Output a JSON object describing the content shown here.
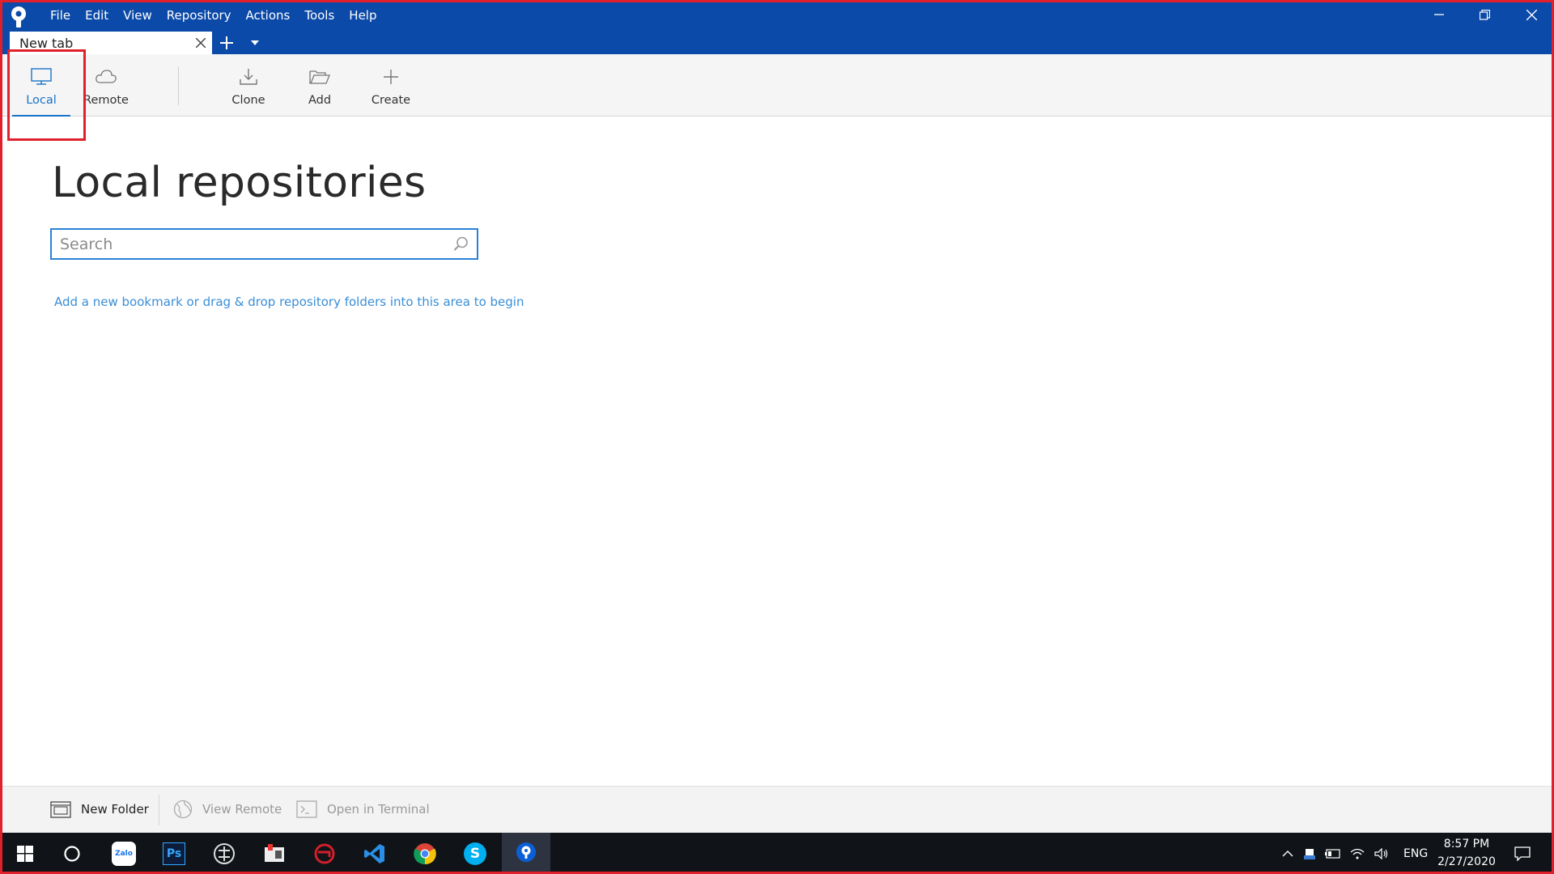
{
  "window": {
    "menu": [
      "File",
      "Edit",
      "View",
      "Repository",
      "Actions",
      "Tools",
      "Help"
    ],
    "controls": {
      "minimize": "minimize-icon",
      "restore": "restore-icon",
      "close": "close-icon"
    },
    "accent_color": "#0b4aa8"
  },
  "tabs": {
    "items": [
      {
        "label": "New tab",
        "active": true
      }
    ],
    "add_icon": "plus-icon",
    "menu_icon": "chevron-down-icon"
  },
  "toolbar": {
    "local_label": "Local",
    "remote_label": "Remote",
    "clone_label": "Clone",
    "add_label": "Add",
    "create_label": "Create",
    "active_tab": "Local",
    "active_color": "#1a73c9"
  },
  "main": {
    "title": "Local repositories",
    "search": {
      "placeholder": "Search",
      "value": ""
    },
    "hint": "Add a new bookmark or drag & drop repository folders into this area to begin"
  },
  "footer": {
    "new_folder_label": "New Folder",
    "view_remote_label": "View Remote",
    "open_terminal_label": "Open in Terminal"
  },
  "taskbar": {
    "apps": [
      "windows-start-icon",
      "cortana-search-icon",
      "zalo-icon",
      "photoshop-icon",
      "app-icon",
      "app-icon",
      "app-icon",
      "vscode-icon",
      "chrome-icon",
      "skype-icon",
      "sourcetree-icon"
    ],
    "zalo_text": "Zalo",
    "photoshop_text": "Ps",
    "skype_text": "S",
    "language": "ENG",
    "time": "8:57 PM",
    "date": "2/27/2020"
  },
  "annotation": {
    "highlight_color": "#e0202a"
  }
}
